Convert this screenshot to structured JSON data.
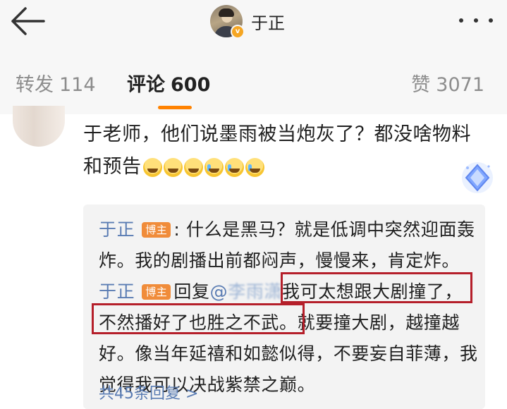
{
  "nav": {
    "title": "于正",
    "verified_badge": "v",
    "icons": [
      "back-arrow-icon",
      "more-dots-icon"
    ]
  },
  "tabs": [
    {
      "label": "转发",
      "count": "114",
      "active": false
    },
    {
      "label": "评论",
      "count": "600",
      "active": true
    },
    {
      "label": "赞",
      "count": "3071",
      "active": false
    }
  ],
  "comment": {
    "text": "于老师，他们说墨雨被当炮灰了？都没啥物料和预告",
    "emoji_count": 6
  },
  "replies": [
    {
      "name": "于正",
      "tag": "博主",
      "text": ": 什么是黑马？就是低调中突然迎面轰炸。我的剧播出前都闷声，慢慢来，肯定炸。"
    },
    {
      "name": "于正",
      "tag": "博主",
      "action": "回复",
      "mention_prefix": "@",
      "mention_obscured": "李雨潇",
      "highlight_1": "我可太想跟大剧撞了，",
      "highlight_2": "不然播好了也胜之不武。",
      "text_after": "就要撞大剧，越撞越好。像当年延禧和如懿似得，不要妄自菲薄，我觉得我可以决战紫禁之巅。"
    }
  ],
  "more_replies": "共45条回复 >",
  "colors": {
    "accent": "#ff8200",
    "link": "#5a7cb3",
    "highlight_border": "#b51f2a",
    "author_tag": "#f08c3a"
  }
}
